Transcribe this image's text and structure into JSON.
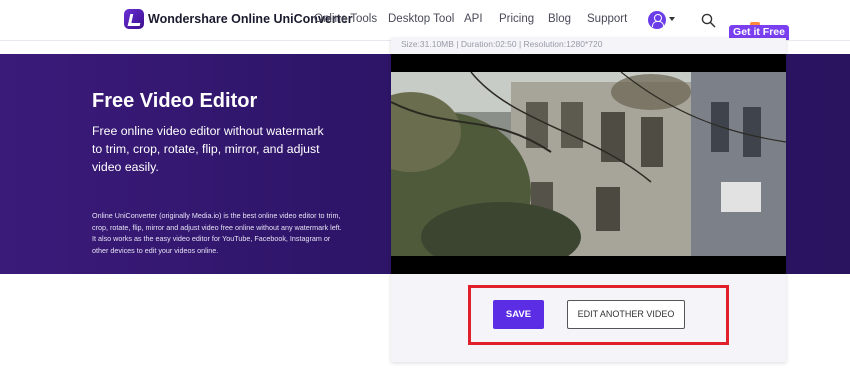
{
  "header": {
    "brand": "Wondershare Online UniConverter",
    "nav": [
      "Online Tools",
      "Desktop Tool",
      "API",
      "Pricing",
      "Blog",
      "Support"
    ],
    "get_free": "Get it Free"
  },
  "hero": {
    "title": "Free Video Editor",
    "subtitle": "Free online video editor without watermark to trim, crop, rotate, flip, mirror, and adjust video easily.",
    "description": "Online UniConverter (originally Media.io) is the best online video editor to trim, crop, rotate, flip, mirror and adjust video free online without any watermark left. It also works as the easy video editor for YouTube, Facebook, Instagram or other devices to edit your videos online."
  },
  "editor": {
    "file_info": "Size:31.10MB | Duration:02:50 | Resolution:1280*720",
    "save_label": "SAVE",
    "edit_another_label": "EDIT ANOTHER VIDEO"
  },
  "colors": {
    "accent": "#5b2ee6",
    "highlight": "#e0202a",
    "hero_bg": "#2e1569"
  },
  "icons": [
    "logo-icon",
    "avatar-icon",
    "chevron-down-icon",
    "search-icon"
  ]
}
